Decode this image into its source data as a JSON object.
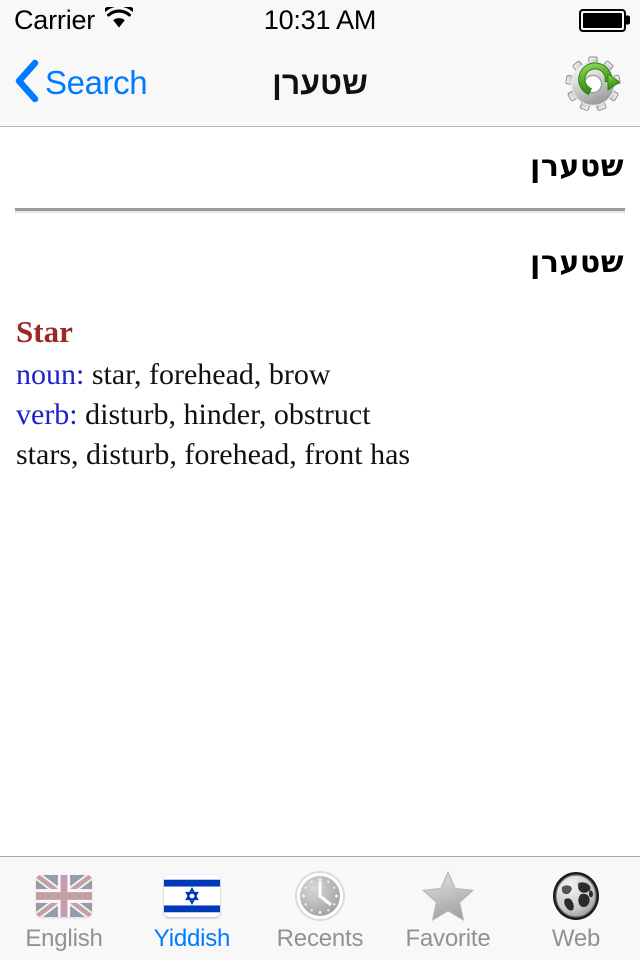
{
  "status_bar": {
    "carrier": "Carrier",
    "wifi_icon": "wifi-icon",
    "time": "10:31 AM",
    "battery_icon": "battery-full-icon"
  },
  "nav_bar": {
    "back_icon": "chevron-left-icon",
    "back_label": "Search",
    "title": "שטערן",
    "action_icon": "gear-refresh-icon"
  },
  "entry": {
    "headword_top": "שטערן",
    "headword_bottom": "שטערן",
    "definition": {
      "title": "Star",
      "senses": [
        {
          "pos": "noun:",
          "text": " star, forehead, brow"
        },
        {
          "pos": "verb:",
          "text": " disturb, hinder, obstruct"
        }
      ],
      "extra": "stars, disturb, forehead, front has"
    }
  },
  "tab_bar": {
    "items": [
      {
        "label": "English",
        "icon": "uk-flag-icon",
        "active": false
      },
      {
        "label": "Yiddish",
        "icon": "israel-flag-icon",
        "active": true
      },
      {
        "label": "Recents",
        "icon": "clock-icon",
        "active": false
      },
      {
        "label": "Favorite",
        "icon": "star-icon",
        "active": false
      },
      {
        "label": "Web",
        "icon": "globe-icon",
        "active": false
      }
    ]
  },
  "colors": {
    "ios_blue": "#007aff",
    "def_title": "#9d2727",
    "pos_blue": "#2121cc",
    "bar_bg": "#f8f8f8",
    "inactive_label": "#929292"
  }
}
